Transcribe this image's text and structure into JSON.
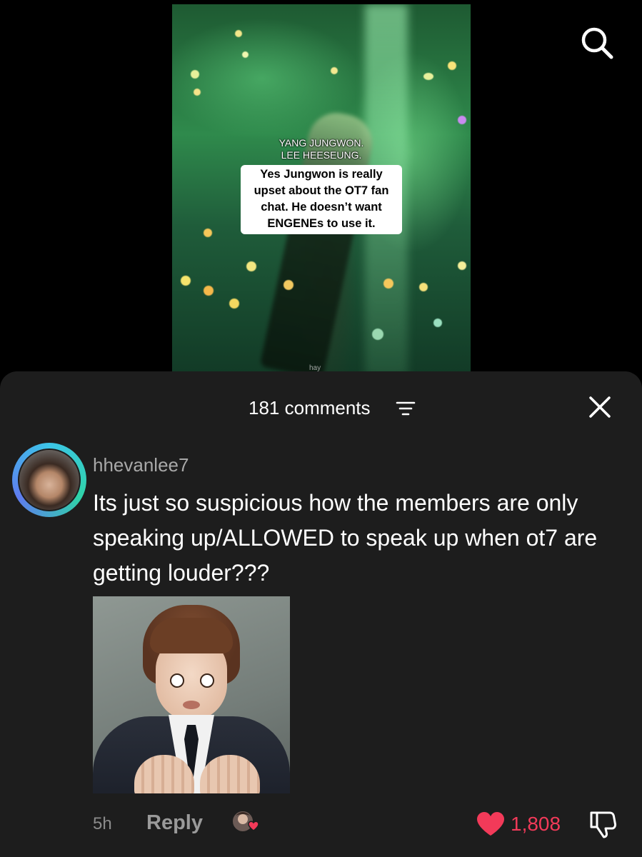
{
  "video": {
    "overlay_names": [
      "YANG JUNGWON.",
      "LEE HEESEUNG."
    ],
    "caption": "Yes Jungwon is really upset about the OT7 fan chat. He doesn’t want ENGENEs to use it.",
    "watermark": "hay",
    "search_icon": "search-icon"
  },
  "sheet": {
    "title": "181 comments",
    "sort_icon": "sort-lines-icon",
    "close_icon": "close-x-icon"
  },
  "comment": {
    "username": "hhevanlee7",
    "text": "Its just so suspicious how the members are only speaking up/ALLOWED to speak up when ot7 are getting louder???",
    "time": "5h",
    "reply_label": "Reply",
    "likes": "1,808",
    "like_color": "#f23a59",
    "avatar_ring_colors": [
      "#3cc6e8",
      "#2fd3a8",
      "#5f7cf0"
    ]
  }
}
